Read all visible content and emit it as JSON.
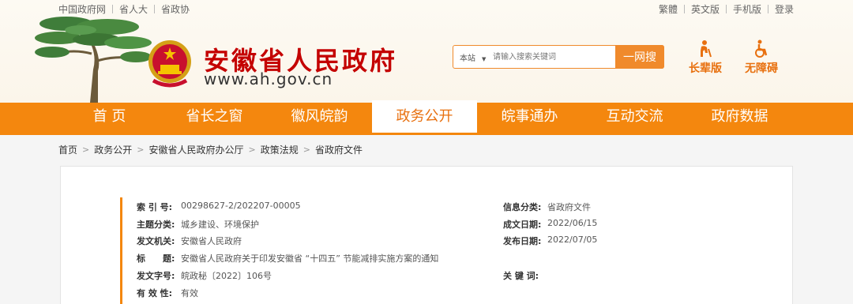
{
  "top_links": [
    "中国政府网",
    "省人大",
    "省政协"
  ],
  "right_links": [
    "繁體",
    "英文版",
    "手机版",
    "登录"
  ],
  "site": {
    "title": "安徽省人民政府",
    "url": "www.ah.gov.cn"
  },
  "search": {
    "scope": "本站",
    "placeholder": "请输入搜索关键词",
    "button": "一网搜"
  },
  "tools": {
    "elder": "长辈版",
    "accessible": "无障碍"
  },
  "nav": [
    "首 页",
    "省长之窗",
    "徽风皖韵",
    "政务公开",
    "皖事通办",
    "互动交流",
    "政府数据"
  ],
  "nav_active_index": 3,
  "breadcrumb": [
    "首页",
    "政务公开",
    "安徽省人民政府办公厅",
    "政策法规",
    "省政府文件"
  ],
  "doc_info": {
    "left": [
      {
        "key": "索 引 号:",
        "value": "00298627-2/202207-00005"
      },
      {
        "key": "主题分类:",
        "value": "城乡建设、环境保护"
      },
      {
        "key": "发文机关:",
        "value": "安徽省人民政府"
      },
      {
        "key": "标　　题:",
        "value": "安徽省人民政府关于印发安徽省 “十四五” 节能减排实施方案的通知"
      },
      {
        "key": "发文字号:",
        "value": "皖政秘〔2022〕106号"
      },
      {
        "key": "有 效 性:",
        "value": "有效"
      }
    ],
    "right": [
      {
        "key": "信息分类:",
        "value": "省政府文件"
      },
      {
        "key": "成文日期:",
        "value": "2022/06/15"
      },
      {
        "key": "发布日期:",
        "value": "2022/07/05"
      },
      {
        "key": "关 键 词:",
        "value": ""
      }
    ]
  },
  "colors": {
    "accent": "#f4870e",
    "title_red": "#c40000"
  }
}
